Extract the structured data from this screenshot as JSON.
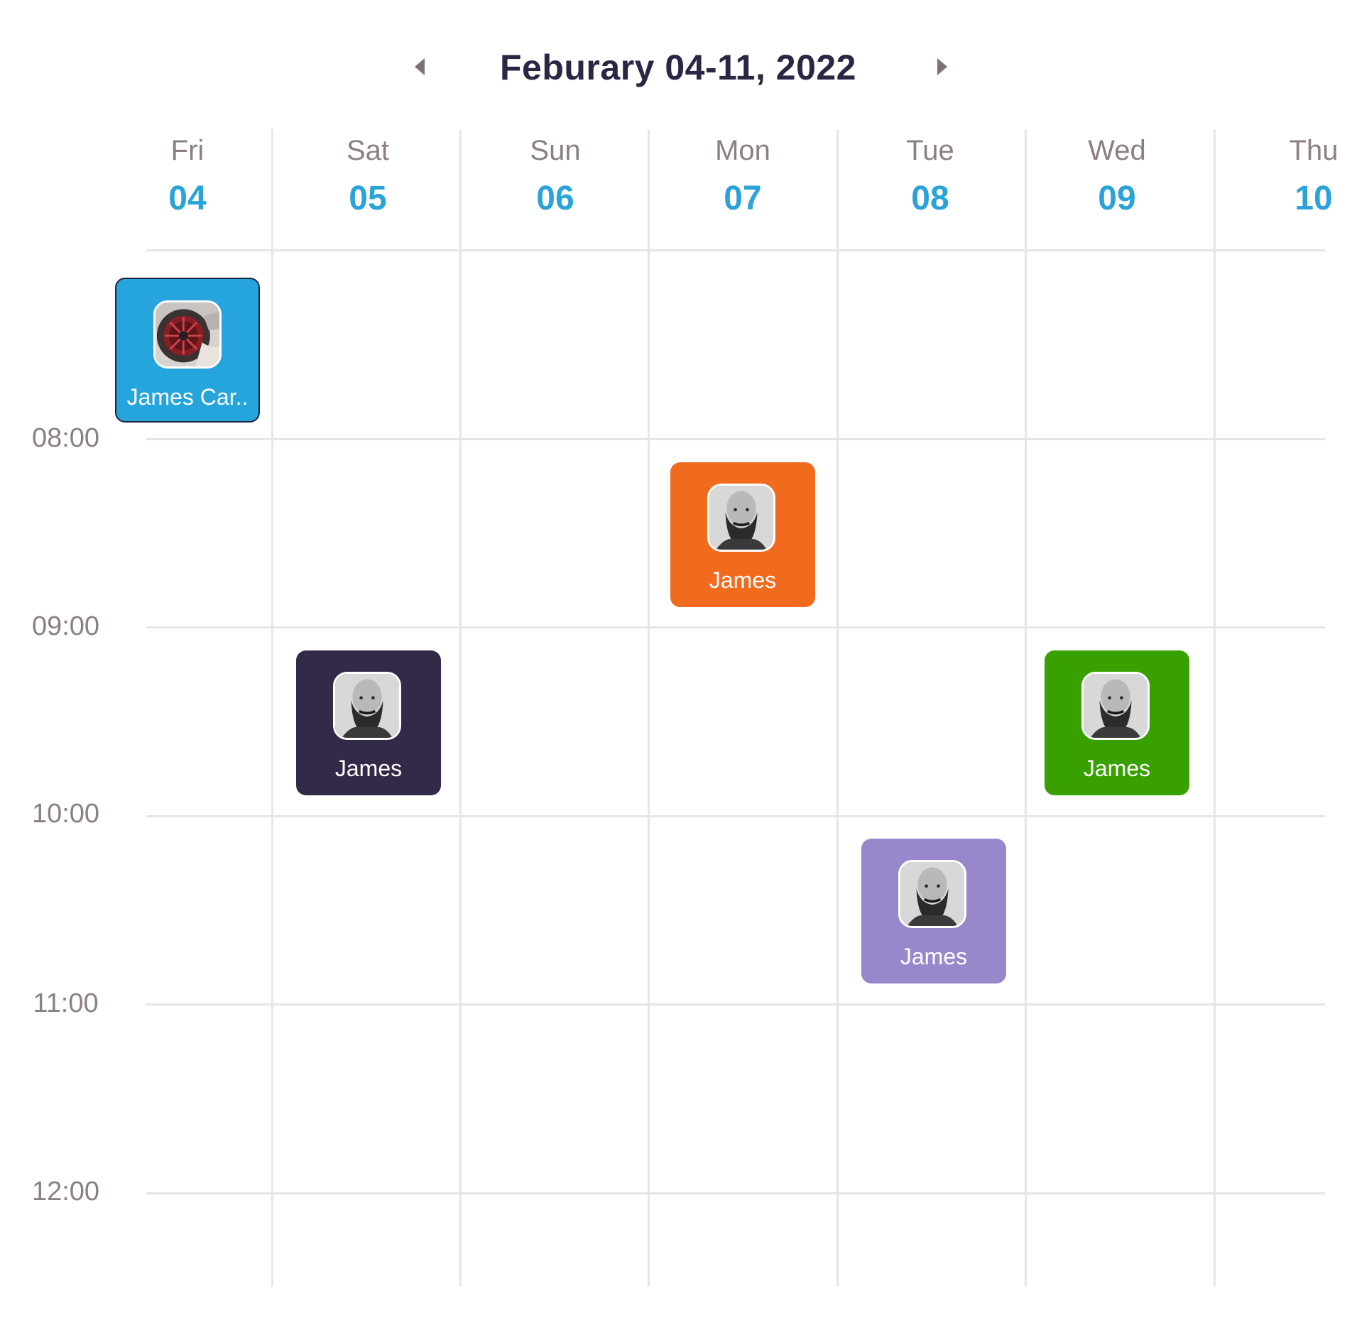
{
  "header": {
    "title": "Feburary 04-11, 2022",
    "prev_icon": "caret-left-icon",
    "next_icon": "caret-right-icon",
    "arrow_color": "#7d7377"
  },
  "days": [
    {
      "name": "Fri",
      "num": "04"
    },
    {
      "name": "Sat",
      "num": "05"
    },
    {
      "name": "Sun",
      "num": "06"
    },
    {
      "name": "Mon",
      "num": "07"
    },
    {
      "name": "Tue",
      "num": "08"
    },
    {
      "name": "Wed",
      "num": "09"
    },
    {
      "name": "Thu",
      "num": "10"
    }
  ],
  "times": [
    "08:00",
    "09:00",
    "10:00",
    "11:00",
    "12:00"
  ],
  "events": [
    {
      "label": "James Car..",
      "day": "Fri",
      "color": "#25a5dc",
      "avatar": "car-wheel-photo"
    },
    {
      "label": "James",
      "day": "Mon",
      "color": "#f06b1e",
      "avatar": "bearded-man-photo"
    },
    {
      "label": "James",
      "day": "Sat",
      "color": "#322a48",
      "avatar": "bearded-man-photo"
    },
    {
      "label": "James",
      "day": "Wed",
      "color": "#38a000",
      "avatar": "bearded-man-photo"
    },
    {
      "label": "James",
      "day": "Tue",
      "color": "#9888cb",
      "avatar": "bearded-man-photo"
    }
  ],
  "colors": {
    "title": "#2b2644",
    "day_number": "#29a3d8",
    "muted_text": "#8a7f85",
    "grid": "#e6e6e6"
  }
}
